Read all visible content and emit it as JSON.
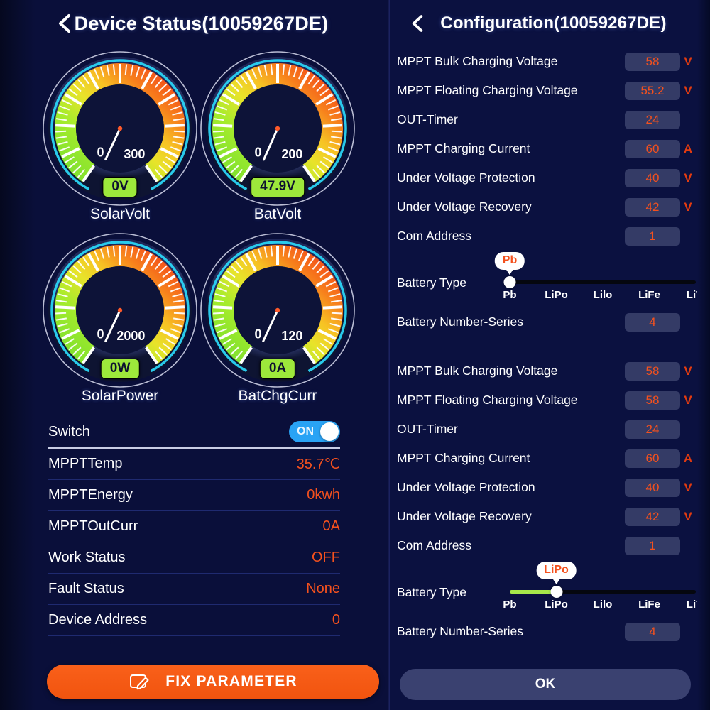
{
  "left": {
    "title": "Device Status(10059267DE)",
    "back_icon": "chevron-left-icon",
    "gauges": [
      {
        "name": "SolarVolt",
        "min_label": "0",
        "max_label": "300",
        "value": "0V",
        "needle_deg": 205
      },
      {
        "name": "BatVolt",
        "min_label": "0",
        "max_label": "200",
        "value": "47.9V",
        "needle_deg": 204
      },
      {
        "name": "SolarPower",
        "name2": "",
        "min_label": "0",
        "max_label": "2000",
        "value": "0W",
        "needle_deg": 205
      },
      {
        "name": "BatChgCurr",
        "min_label": "0",
        "max_label": "120",
        "value": "0A",
        "needle_deg": 205
      }
    ],
    "switch": {
      "label": "Switch",
      "state": "ON"
    },
    "status_rows": [
      {
        "label": "MPPTTemp",
        "value": "35.7℃"
      },
      {
        "label": "MPPTEnergy",
        "value": "0kwh"
      },
      {
        "label": "MPPTOutCurr",
        "value": "0A"
      },
      {
        "label": "Work Status",
        "value": "OFF"
      },
      {
        "label": "Fault Status",
        "value": "None"
      },
      {
        "label": "Device Address",
        "value": "0"
      }
    ],
    "fix_button": {
      "label": "FIX PARAMETER",
      "icon": "edit-pencil-icon"
    }
  },
  "right": {
    "title": "Configuration(10059267DE)",
    "back_icon": "chevron-left-icon",
    "section1": {
      "rows": [
        {
          "label": "MPPT Bulk Charging Voltage",
          "value": "58",
          "unit": "V"
        },
        {
          "label": "MPPT Floating Charging Voltage",
          "value": "55.2",
          "unit": "V"
        },
        {
          "label": "OUT-Timer",
          "value": "24",
          "unit": ""
        },
        {
          "label": "MPPT Charging Current",
          "value": "60",
          "unit": "A"
        },
        {
          "label": "Under Voltage Protection",
          "value": "40",
          "unit": "V"
        },
        {
          "label": "Under Voltage Recovery",
          "value": "42",
          "unit": "V"
        },
        {
          "label": "Com Address",
          "value": "1",
          "unit": ""
        }
      ],
      "battery_type": {
        "label": "Battery Type",
        "options": [
          "Pb",
          "LiPo",
          "Lilo",
          "LiFe",
          "LiTi"
        ],
        "selected": "Pb",
        "selected_index": 0
      },
      "series_row": {
        "label": "Battery Number-Series",
        "value": "4",
        "unit": ""
      }
    },
    "section2": {
      "rows": [
        {
          "label": "MPPT Bulk Charging Voltage",
          "value": "58",
          "unit": "V"
        },
        {
          "label": "MPPT Floating Charging Voltage",
          "value": "58",
          "unit": "V"
        },
        {
          "label": "OUT-Timer",
          "value": "24",
          "unit": ""
        },
        {
          "label": "MPPT Charging Current",
          "value": "60",
          "unit": "A"
        },
        {
          "label": "Under Voltage Protection",
          "value": "40",
          "unit": "V"
        },
        {
          "label": "Under Voltage Recovery",
          "value": "42",
          "unit": "V"
        },
        {
          "label": "Com Address",
          "value": "1",
          "unit": ""
        }
      ],
      "battery_type": {
        "label": "Battery Type",
        "options": [
          "Pb",
          "LiPo",
          "Lilo",
          "LiFe",
          "LiTi"
        ],
        "selected": "LiPo",
        "selected_index": 1
      },
      "series_row": {
        "label": "Battery Number-Series",
        "value": "4",
        "unit": ""
      }
    },
    "ok_button": {
      "label": "OK"
    }
  },
  "colors": {
    "accent_orange": "#f4511e",
    "badge_green": "#9de83b",
    "toggle_blue": "#29a3f5",
    "panel_bg": "#0a0f3a",
    "field_bg": "#343b66",
    "gauge_ring": "#2ad4f5"
  }
}
